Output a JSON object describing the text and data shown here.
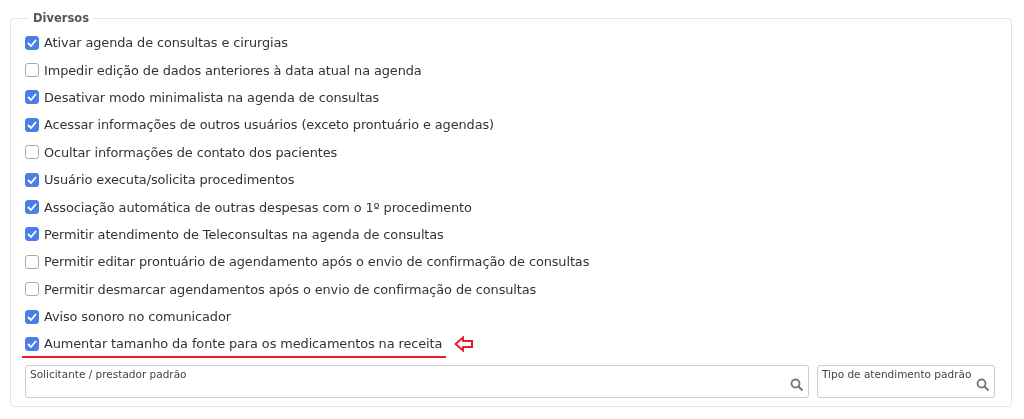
{
  "section": {
    "title": "Diversos",
    "options": [
      {
        "label": "Ativar agenda de consultas e cirurgias",
        "checked": true,
        "highlighted": false
      },
      {
        "label": "Impedir edição de dados anteriores à data atual na agenda",
        "checked": false,
        "highlighted": false
      },
      {
        "label": "Desativar modo minimalista na agenda de consultas",
        "checked": true,
        "highlighted": false
      },
      {
        "label": "Acessar informações de outros usuários (exceto prontuário e agendas)",
        "checked": true,
        "highlighted": false
      },
      {
        "label": "Ocultar informações de contato dos pacientes",
        "checked": false,
        "highlighted": false
      },
      {
        "label": "Usuário executa/solicita procedimentos",
        "checked": true,
        "highlighted": false
      },
      {
        "label": "Associação automática de outras despesas com o 1º procedimento",
        "checked": true,
        "highlighted": false
      },
      {
        "label": "Permitir atendimento de Teleconsultas na agenda de consultas",
        "checked": true,
        "highlighted": false
      },
      {
        "label": "Permitir editar prontuário de agendamento após o envio de confirmação de consultas",
        "checked": false,
        "highlighted": false
      },
      {
        "label": "Permitir desmarcar agendamentos após o envio de confirmação de consultas",
        "checked": false,
        "highlighted": false
      },
      {
        "label": "Aviso sonoro no comunicador",
        "checked": true,
        "highlighted": false
      },
      {
        "label": "Aumentar tamanho da fonte para os medicamentos na receita",
        "checked": true,
        "highlighted": true
      }
    ],
    "fields": [
      {
        "label": "Solicitante / prestador padrão"
      },
      {
        "label": "Tipo de atendimento padrão"
      }
    ]
  }
}
